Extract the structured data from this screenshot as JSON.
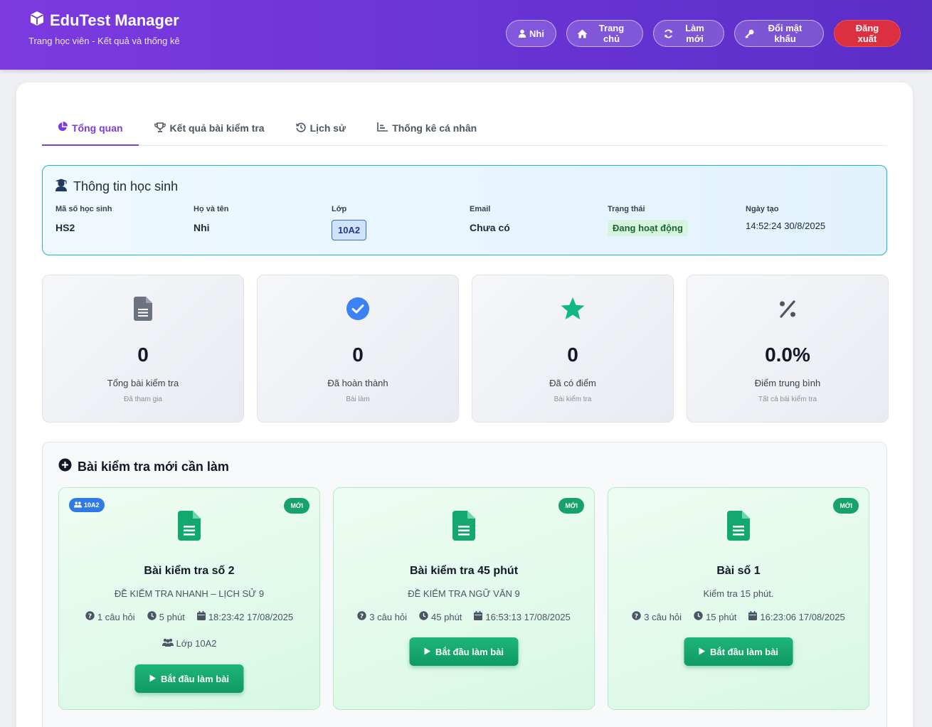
{
  "header": {
    "title": "EduTest Manager",
    "subtitle": "Trang học viên - Kết quả và thống kê",
    "nav": {
      "user": "Nhi",
      "home": "Trang chủ",
      "refresh": "Làm mới",
      "password": "Đổi mật khẩu",
      "logout": "Đăng xuất"
    },
    "colors": {
      "gradient_start": "#7c3ae0",
      "gradient_end": "#5b2ec6",
      "logout": "#dc2f3f"
    }
  },
  "tabs": [
    {
      "label": "Tổng quan",
      "icon": "pie-chart-icon",
      "active": true
    },
    {
      "label": "Kết quả bài kiểm tra",
      "icon": "trophy-icon"
    },
    {
      "label": "Lịch sử",
      "icon": "history-icon"
    },
    {
      "label": "Thống kê cá nhân",
      "icon": "bar-chart-icon"
    }
  ],
  "student": {
    "title": "Thông tin học sinh",
    "fields": {
      "id": {
        "label": "Mã số học sinh",
        "value": "HS2"
      },
      "name": {
        "label": "Họ và tên",
        "value": "Nhi"
      },
      "class": {
        "label": "Lớp",
        "value": "10A2"
      },
      "email": {
        "label": "Email",
        "value": "Chưa có"
      },
      "status": {
        "label": "Trạng thái",
        "value": "Đang hoạt động"
      },
      "created": {
        "label": "Ngày tạo",
        "value": "14:52:24 30/8/2025"
      }
    }
  },
  "stats": [
    {
      "value": "0",
      "label": "Tổng bài kiểm tra",
      "sub": "Đã tham gia",
      "icon": "document-icon"
    },
    {
      "value": "0",
      "label": "Đã hoàn thành",
      "sub": "Bài làm",
      "icon": "check-circle-icon"
    },
    {
      "value": "0",
      "label": "Đã có điểm",
      "sub": "Bài kiểm tra",
      "icon": "star-icon"
    },
    {
      "value": "0.0%",
      "label": "Điểm trung bình",
      "sub": "Tất cả bài kiểm tra",
      "icon": "percent-icon"
    }
  ],
  "new_tests": {
    "title": "Bài kiểm tra mới cần làm",
    "start_label": "Bắt đầu làm bài",
    "new_label": "MỚI",
    "items": [
      {
        "class_badge": "10A2",
        "title": "Bài kiểm tra số 2",
        "description": "ĐỀ KIỂM TRA NHANH – LỊCH SỬ 9",
        "questions": "1 câu hỏi",
        "duration": "5 phút",
        "date": "18:23:42 17/08/2025",
        "class_line": "Lớp 10A2"
      },
      {
        "title": "Bài kiểm tra 45 phút",
        "description": "ĐỀ KIỂM TRA NGỮ VĂN 9",
        "questions": "3 câu hỏi",
        "duration": "45 phút",
        "date": "16:53:13 17/08/2025"
      },
      {
        "title": "Bài số 1",
        "description": "Kiểm tra 15 phút.",
        "questions": "3 câu hỏi",
        "duration": "15 phút",
        "date": "16:23:06 17/08/2025"
      }
    ]
  }
}
